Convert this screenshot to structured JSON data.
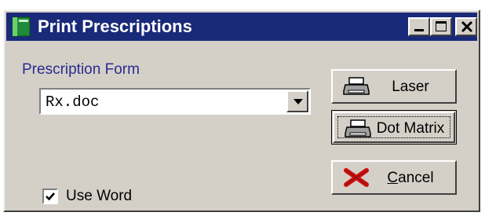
{
  "window": {
    "title": "Print Prescriptions"
  },
  "form": {
    "label": "Prescription Form",
    "selected": "Rx.doc"
  },
  "use_word": {
    "label": "Use Word",
    "checked": true
  },
  "buttons": {
    "laser": {
      "label": "Laser",
      "icon": "printer-icon"
    },
    "dot_matrix": {
      "label": "Dot Matrix",
      "icon": "printer-icon"
    },
    "cancel": {
      "accel": "C",
      "rest": "ancel",
      "icon": "red-x-icon"
    }
  },
  "colors": {
    "titlebar": "#1a2a7a",
    "face": "#d4d0c8",
    "label_text": "#2a2a90",
    "cancel_icon": "#cc1111"
  }
}
